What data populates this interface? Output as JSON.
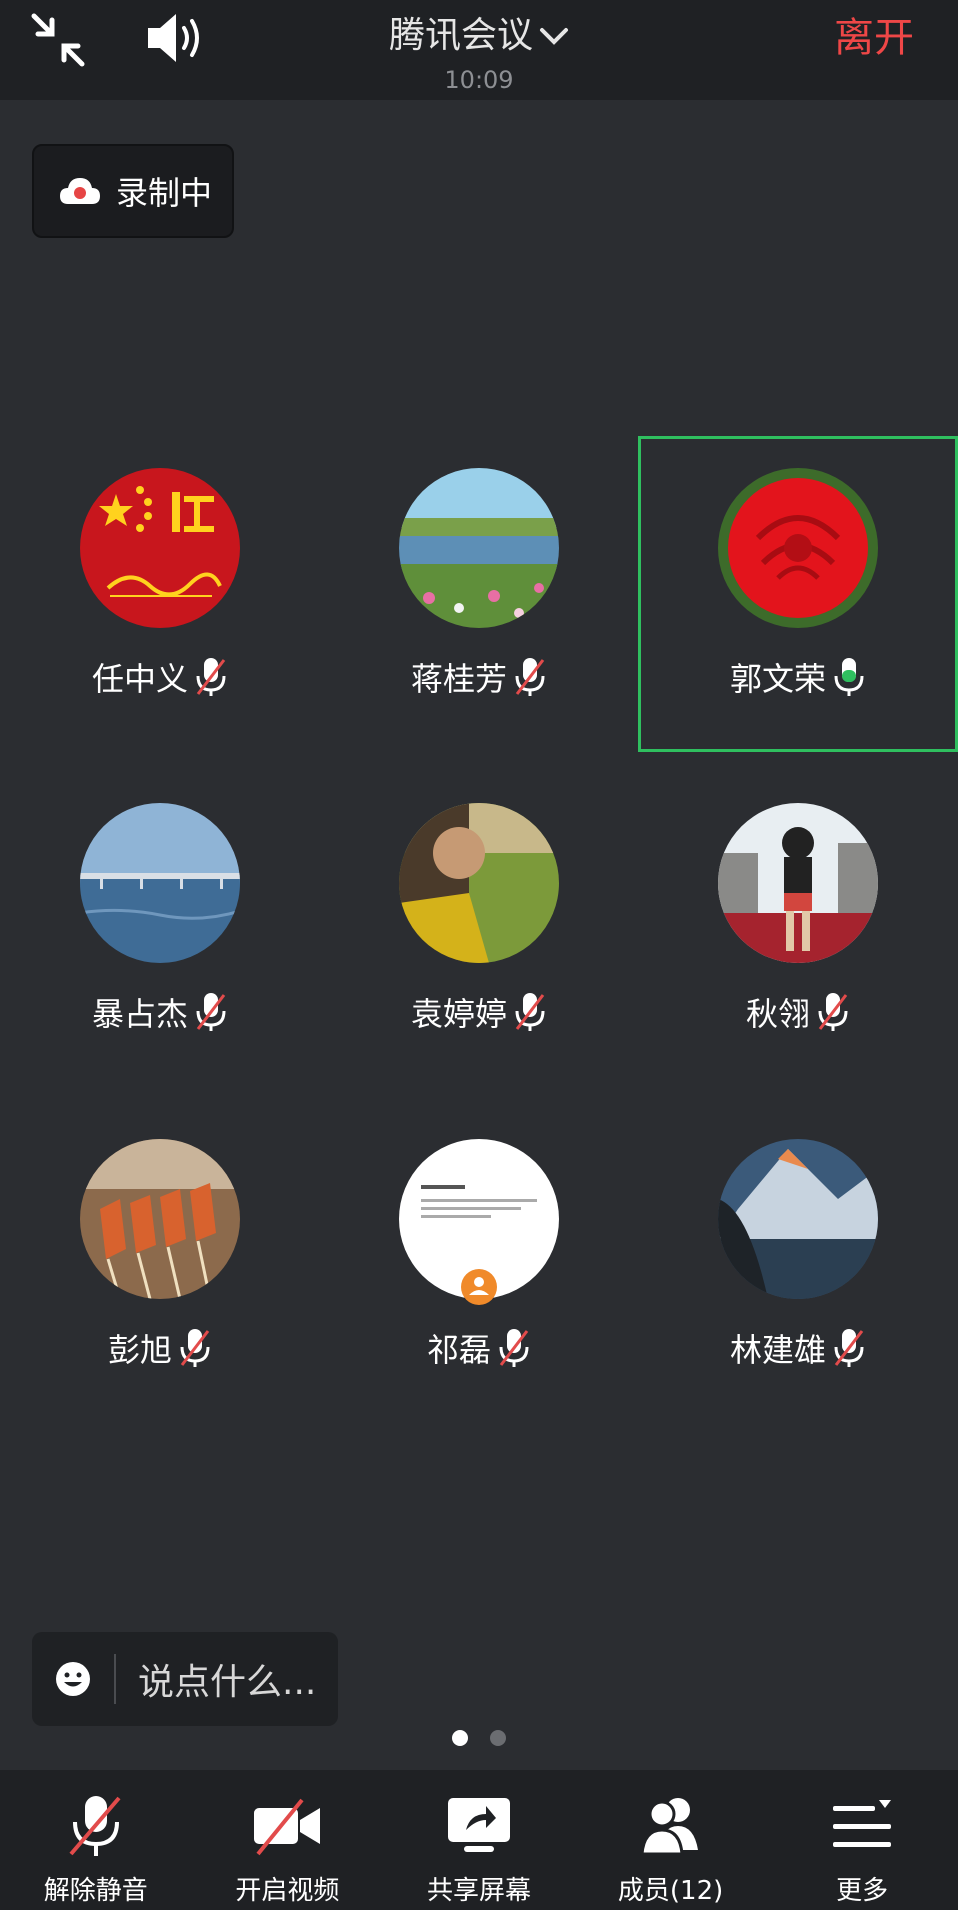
{
  "topbar": {
    "title": "腾讯会议",
    "time": "10:09",
    "leave_label": "离开"
  },
  "recording": {
    "label": "录制中"
  },
  "participants": [
    {
      "name": "任中义",
      "mic": "muted",
      "avatar": "red-flag-avatar"
    },
    {
      "name": "蒋桂芳",
      "mic": "muted",
      "avatar": "lake-landscape-avatar"
    },
    {
      "name": "郭文荣",
      "mic": "speaking",
      "avatar": "red-rose-avatar",
      "active": true
    },
    {
      "name": "暴占杰",
      "mic": "muted",
      "avatar": "sea-bridge-avatar"
    },
    {
      "name": "袁婷婷",
      "mic": "muted",
      "avatar": "person-in-park-avatar"
    },
    {
      "name": "秋翎",
      "mic": "muted",
      "avatar": "child-at-castle-avatar"
    },
    {
      "name": "彭旭",
      "mic": "muted",
      "avatar": "food-avatar"
    },
    {
      "name": "祁磊",
      "mic": "muted",
      "avatar": "screenshot-avatar"
    },
    {
      "name": "林建雄",
      "mic": "muted",
      "avatar": "mountain-avatar"
    }
  ],
  "chat": {
    "placeholder": "说点什么..."
  },
  "pagination": {
    "current": 1,
    "total": 2
  },
  "toolbar": {
    "unmute_label": "解除静音",
    "video_label": "开启视频",
    "share_label": "共享屏幕",
    "members_label": "成员(12)",
    "more_label": "更多"
  },
  "colors": {
    "leave": "#ef4747",
    "active_border": "#2fbf5f",
    "muted_slash": "#e24b4b",
    "speaking_mic": "#2fbf5f"
  }
}
